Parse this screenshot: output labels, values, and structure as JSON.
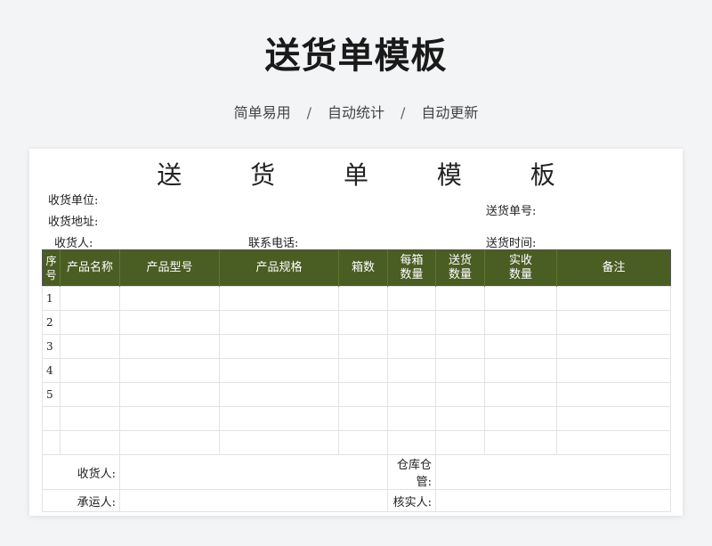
{
  "banner": {
    "title": "送货单模板",
    "tags": [
      "简单易用",
      "自动统计",
      "自动更新"
    ],
    "separator": "/"
  },
  "sheet": {
    "title": "送 货 单 模 板",
    "meta": {
      "receiver_unit": "收货单位:",
      "receiver_address": "收货地址:",
      "delivery_no": "送货单号:",
      "receiver": "收货人:",
      "phone": "联系电话:",
      "delivery_time": "送货时间:"
    },
    "columns": [
      "序号",
      "产品名称",
      "产品型号",
      "产品规格",
      "箱数",
      "每箱数量",
      "送货数量",
      "实收数量",
      "备注"
    ],
    "rows": [
      "1",
      "2",
      "3",
      "4",
      "5",
      "",
      ""
    ],
    "footer": {
      "receiver": "收货人:",
      "warehouse_keeper": "仓库仓管:",
      "carrier": "承运人:",
      "checker": "核实人:"
    }
  }
}
